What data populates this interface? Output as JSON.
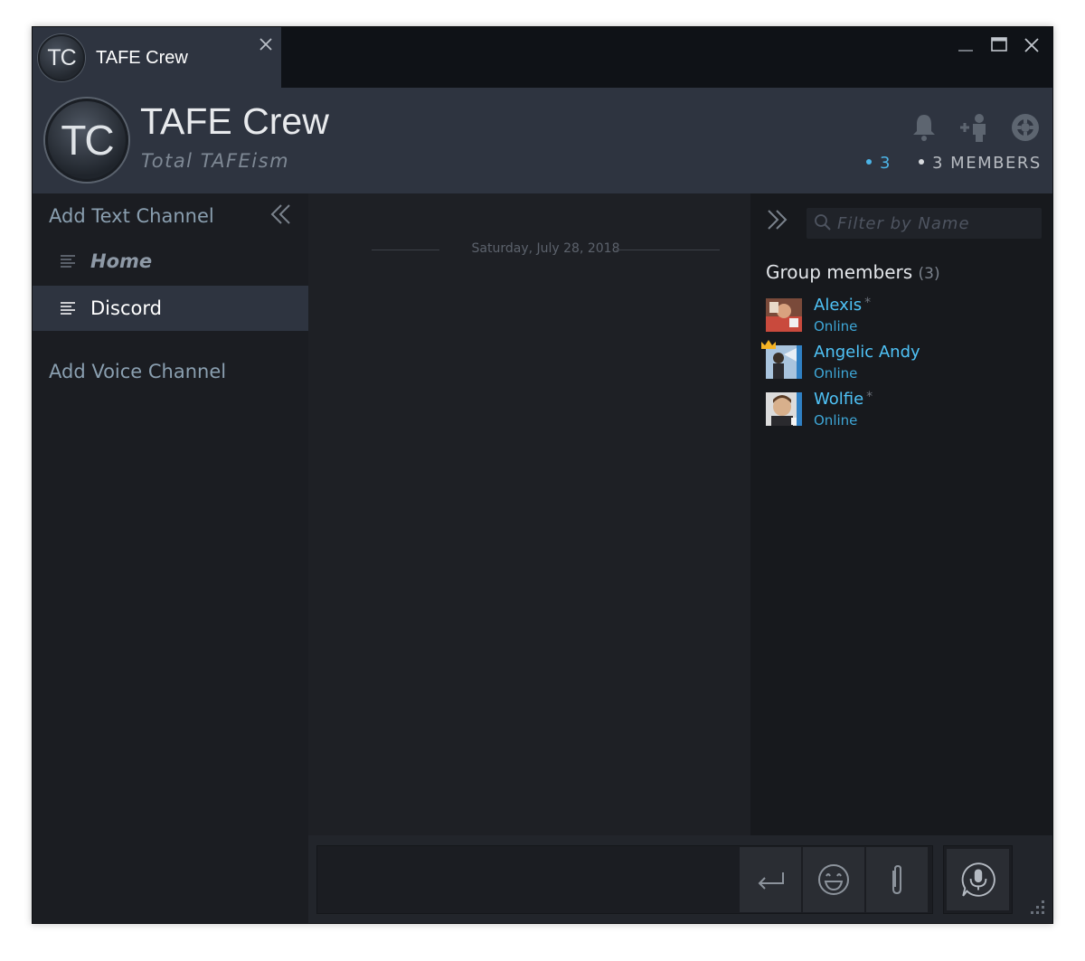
{
  "tab": {
    "avatar_initials": "TC",
    "title": "TAFE Crew"
  },
  "header": {
    "avatar_initials": "TC",
    "group_name": "TAFE Crew",
    "tagline": "Total TAFEism",
    "online_count": "3",
    "members_label": "3 MEMBERS"
  },
  "channels": {
    "add_text_label": "Add Text Channel",
    "items": [
      {
        "label": "Home",
        "active": false
      },
      {
        "label": "Discord",
        "active": true
      }
    ],
    "add_voice_label": "Add Voice Channel"
  },
  "chat": {
    "date_separator": "Saturday, July 28, 2018"
  },
  "members_panel": {
    "filter_placeholder": "Filter by Name",
    "title": "Group members",
    "count": "(3)",
    "members": [
      {
        "name": "Alexis",
        "status": "Online",
        "starred": "*",
        "owner": false
      },
      {
        "name": "Angelic Andy",
        "status": "Online",
        "starred": "",
        "owner": true
      },
      {
        "name": "Wolfie",
        "status": "Online",
        "starred": "*",
        "owner": false
      }
    ]
  },
  "colors": {
    "accent_online": "#4fc3f7",
    "status_text": "#3ea6d6",
    "header_bg": "#2e3440",
    "crown": "#f5b324"
  },
  "icons": {
    "tab_close": "close-icon",
    "window_controls": [
      "minimize-icon",
      "maximize-icon",
      "close-icon"
    ],
    "header": [
      "bell-icon",
      "add-friend-icon",
      "gear-icon"
    ],
    "composer": [
      "enter-icon",
      "emoji-icon",
      "paperclip-icon",
      "voice-chat-icon"
    ]
  }
}
